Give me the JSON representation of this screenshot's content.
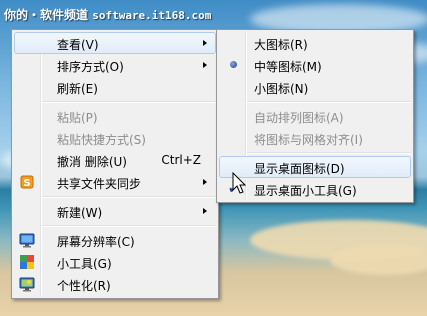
{
  "watermark": {
    "prefix": "你的・软件频道",
    "site": "software.it168.com"
  },
  "context_menu": {
    "items": [
      {
        "label": "查看(V)"
      },
      {
        "label": "排序方式(O)"
      },
      {
        "label": "刷新(E)"
      },
      {
        "label": "粘贴(P)"
      },
      {
        "label": "粘贴快捷方式(S)"
      },
      {
        "label": "撤消 删除(U)",
        "shortcut": "Ctrl+Z"
      },
      {
        "label": "共享文件夹同步"
      },
      {
        "label": "新建(W)"
      },
      {
        "label": "屏幕分辨率(C)"
      },
      {
        "label": "小工具(G)"
      },
      {
        "label": "个性化(R)"
      }
    ]
  },
  "view_submenu": {
    "items": [
      {
        "label": "大图标(R)"
      },
      {
        "label": "中等图标(M)"
      },
      {
        "label": "小图标(N)"
      },
      {
        "label": "自动排列图标(A)"
      },
      {
        "label": "将图标与网格对齐(I)"
      },
      {
        "label": "显示桌面图标(D)"
      },
      {
        "label": "显示桌面小工具(G)"
      }
    ]
  },
  "colors": {
    "menu_bg": "#f0f0f0",
    "hover_border": "#aeccf1",
    "disabled_text": "#8d8d8d"
  }
}
